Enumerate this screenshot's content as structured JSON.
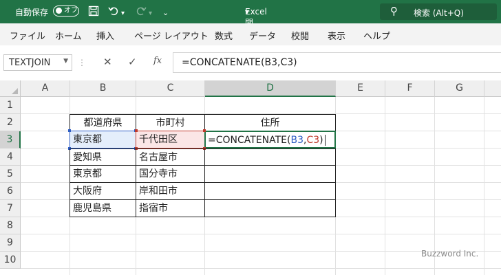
{
  "titlebar": {
    "autosave_label": "自動保存",
    "autosave_state": "オフ",
    "document_title": "Excel関数.xlsx",
    "search_placeholder": "検索 (Alt+Q)",
    "icons": [
      "save-icon",
      "undo-icon",
      "redo-icon",
      "customize-icon"
    ]
  },
  "menu": {
    "items": [
      "ファイル",
      "ホーム",
      "挿入",
      "ページ レイアウト",
      "数式",
      "データ",
      "校閲",
      "表示",
      "ヘルプ"
    ]
  },
  "formula_bar": {
    "name_box": "TEXTJOIN",
    "formula": "=CONCATENATE(B3,C3)"
  },
  "sheet": {
    "columns": [
      "A",
      "B",
      "C",
      "D",
      "E",
      "F",
      "G"
    ],
    "selected_column": "D",
    "rows": [
      "1",
      "2",
      "3",
      "4",
      "5",
      "6",
      "7",
      "8",
      "9",
      "10"
    ],
    "selected_row": "3",
    "table": {
      "headers": [
        "都道府県",
        "市町村",
        "住所"
      ],
      "rows": [
        [
          "東京都",
          "千代田区"
        ],
        [
          "愛知県",
          "名古屋市"
        ],
        [
          "東京都",
          "国分寺市"
        ],
        [
          "大阪府",
          "岸和田市"
        ],
        [
          "鹿児島県",
          "指宿市"
        ]
      ]
    },
    "editing_cell": {
      "prefix": "=CONCATENATE(",
      "ref1": "B3",
      "comma": ",",
      "ref2": "C3",
      "suffix": ")"
    }
  },
  "watermark": "Buzzword Inc.",
  "colors": {
    "titlebar": "#217346",
    "ref_b": "#2f5ec4",
    "ref_c": "#c0392b",
    "selection": "#217346"
  }
}
